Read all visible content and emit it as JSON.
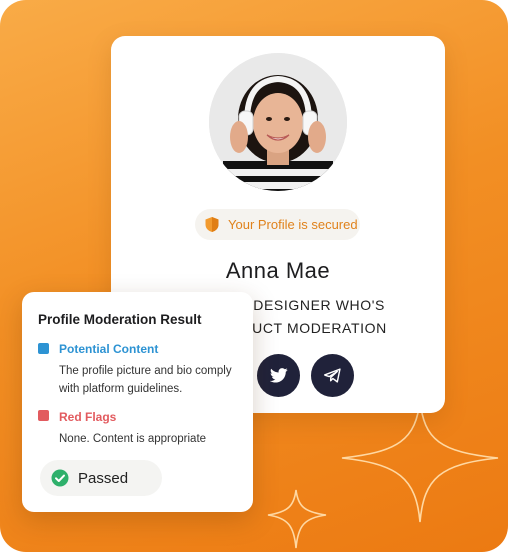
{
  "profile": {
    "security_badge": "Your Profile is secured",
    "name": "Anna Mae",
    "bio_line1": "I'M A UI/UX DESIGNER WHO'S",
    "bio_line2": "INTO PRODUCT MODERATION",
    "social": [
      {
        "icon": "twitter-icon"
      },
      {
        "icon": "telegram-icon"
      }
    ]
  },
  "moderation": {
    "title": "Profile Moderation Result",
    "potential_content": {
      "label": "Potential Content",
      "description": "The profile picture and bio comply with platform guidelines.",
      "color": "#2d93d3"
    },
    "red_flags": {
      "label": "Red Flags",
      "description": "None. Content is appropriate",
      "color": "#e25b5f"
    },
    "status": "Passed"
  },
  "colors": {
    "background": "#f28f24",
    "accent_orange": "#e0821c",
    "button_dark": "#20223a",
    "success_green": "#2eb06b"
  }
}
